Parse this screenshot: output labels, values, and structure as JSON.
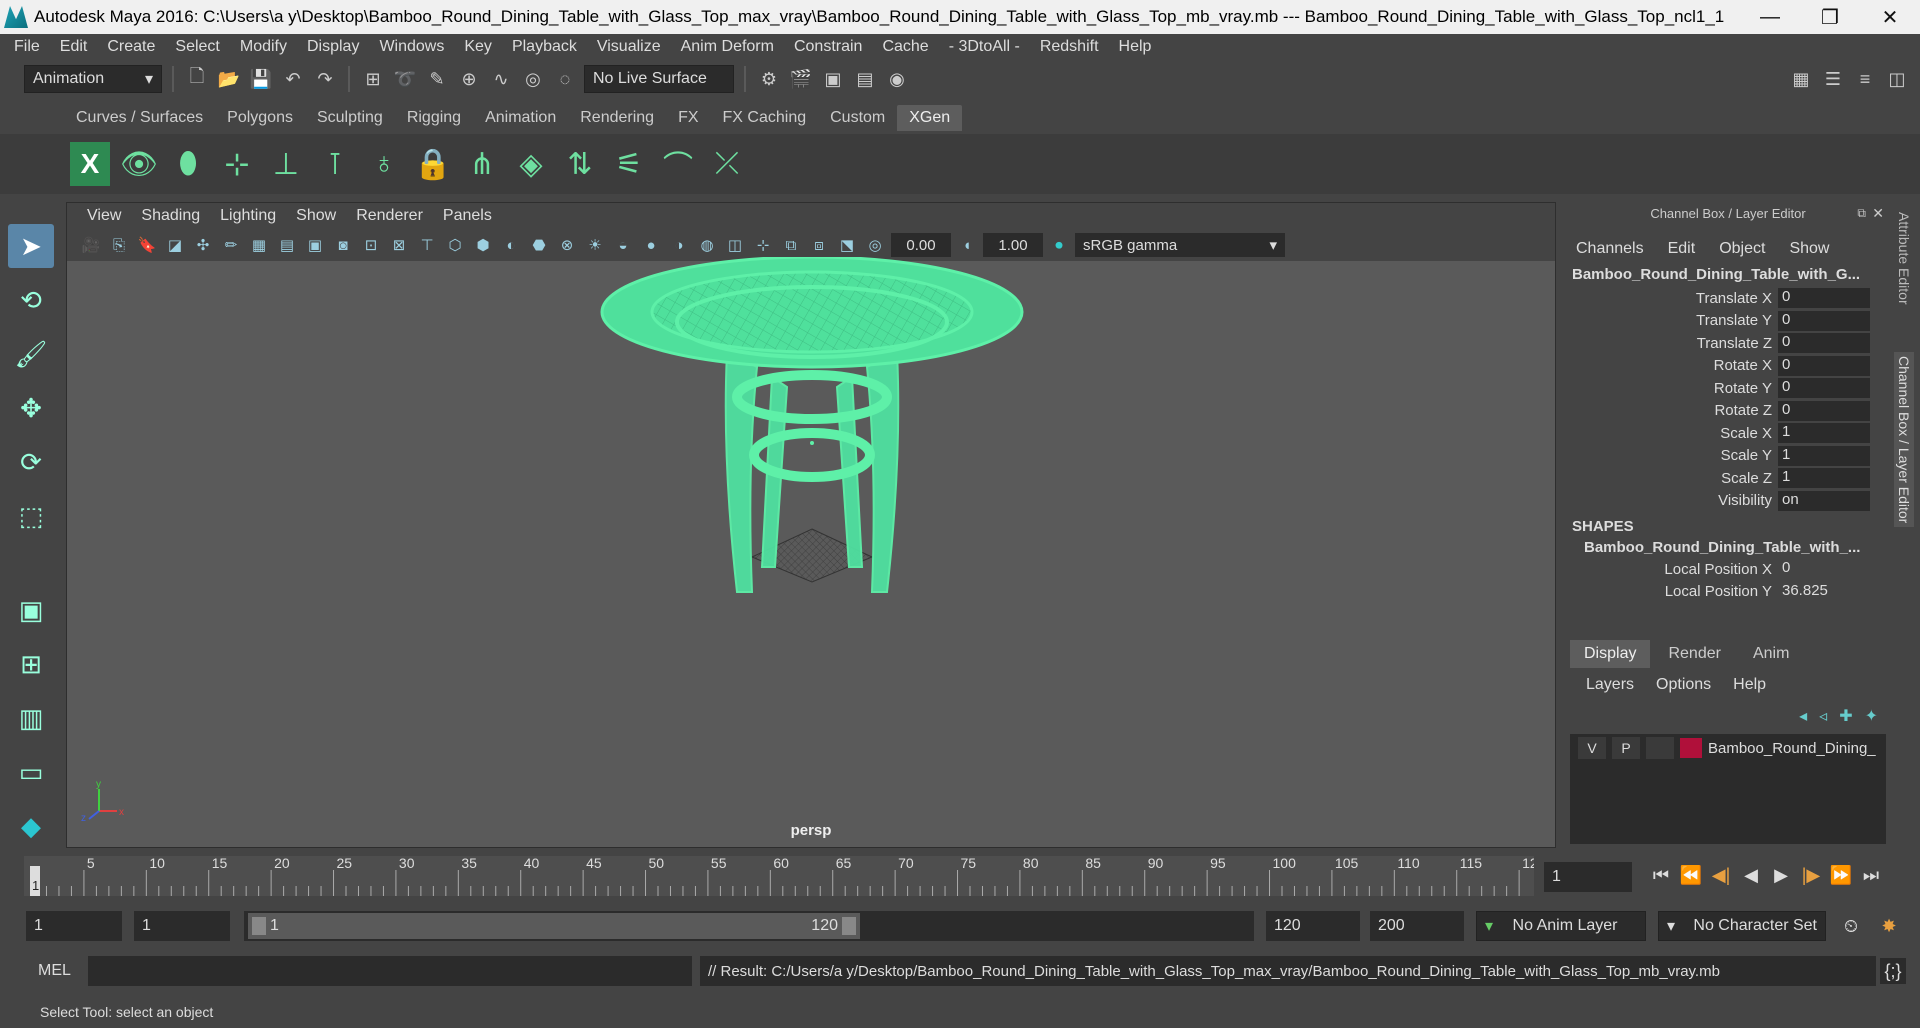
{
  "window": {
    "title": "Autodesk Maya 2016: C:\\Users\\a y\\Desktop\\Bamboo_Round_Dining_Table_with_Glass_Top_max_vray\\Bamboo_Round_Dining_Table_with_Glass_Top_mb_vray.mb   ---   Bamboo_Round_Dining_Table_with_Glass_Top_ncl1_1",
    "minimize": "—",
    "restore": "❐",
    "close": "✕"
  },
  "menubar": [
    "File",
    "Edit",
    "Create",
    "Select",
    "Modify",
    "Display",
    "Windows",
    "Key",
    "Playback",
    "Visualize",
    "Anim Deform",
    "Constrain",
    "Cache",
    "- 3DtoAll -",
    "Redshift",
    "Help"
  ],
  "statusline": {
    "mode": "Animation",
    "live_surface": "No Live Surface"
  },
  "shelf": {
    "tabs": [
      "Curves / Surfaces",
      "Polygons",
      "Sculpting",
      "Rigging",
      "Animation",
      "Rendering",
      "FX",
      "FX Caching",
      "Custom",
      "XGen"
    ],
    "active_tab": "XGen"
  },
  "viewport": {
    "menu": [
      "View",
      "Shading",
      "Lighting",
      "Show",
      "Renderer",
      "Panels"
    ],
    "exposure": "0.00",
    "gamma": "1.00",
    "color_space": "sRGB gamma",
    "camera_label": "persp",
    "axis_x": "x",
    "axis_y": "y",
    "axis_z": "z",
    "wire_color": "#5ef0a8"
  },
  "channelbox": {
    "header": "Channel Box / Layer Editor",
    "menu": [
      "Channels",
      "Edit",
      "Object",
      "Show"
    ],
    "object": "Bamboo_Round_Dining_Table_with_G...",
    "attributes": [
      {
        "name": "Translate X",
        "value": "0"
      },
      {
        "name": "Translate Y",
        "value": "0"
      },
      {
        "name": "Translate Z",
        "value": "0"
      },
      {
        "name": "Rotate X",
        "value": "0"
      },
      {
        "name": "Rotate Y",
        "value": "0"
      },
      {
        "name": "Rotate Z",
        "value": "0"
      },
      {
        "name": "Scale X",
        "value": "1"
      },
      {
        "name": "Scale Y",
        "value": "1"
      },
      {
        "name": "Scale Z",
        "value": "1"
      },
      {
        "name": "Visibility",
        "value": "on"
      }
    ],
    "shapes_label": "SHAPES",
    "shape_object": "Bamboo_Round_Dining_Table_with_...",
    "shape_attributes": [
      {
        "name": "Local Position X",
        "value": "0"
      },
      {
        "name": "Local Position Y",
        "value": "36.825"
      }
    ],
    "layer_tabs": [
      "Display",
      "Render",
      "Anim"
    ],
    "layer_menu": [
      "Layers",
      "Options",
      "Help"
    ],
    "layer": {
      "v": "V",
      "p": "P",
      "name": "Bamboo_Round_Dining_",
      "color": "#b0103a"
    }
  },
  "side_tabs": [
    "Attribute Editor",
    "Channel Box / Layer Editor"
  ],
  "timeline": {
    "ticks": [
      "5",
      "10",
      "15",
      "20",
      "25",
      "30",
      "35",
      "40",
      "45",
      "50",
      "55",
      "60",
      "65",
      "70",
      "75",
      "80",
      "85",
      "90",
      "95",
      "100",
      "105",
      "110",
      "115",
      "12"
    ],
    "current_frame_marker": "1",
    "current_frame": "1"
  },
  "range": {
    "start": "1",
    "playback_start": "1",
    "slider_start": "1",
    "slider_end": "120",
    "playback_end": "120",
    "end": "200",
    "anim_layer": "No Anim Layer",
    "character_set": "No Character Set"
  },
  "cmdline": {
    "lang": "MEL",
    "result": "// Result: C:/Users/a y/Desktop/Bamboo_Round_Dining_Table_with_Glass_Top_max_vray/Bamboo_Round_Dining_Table_with_Glass_Top_mb_vray.mb"
  },
  "helpline": "Select Tool: select an object"
}
